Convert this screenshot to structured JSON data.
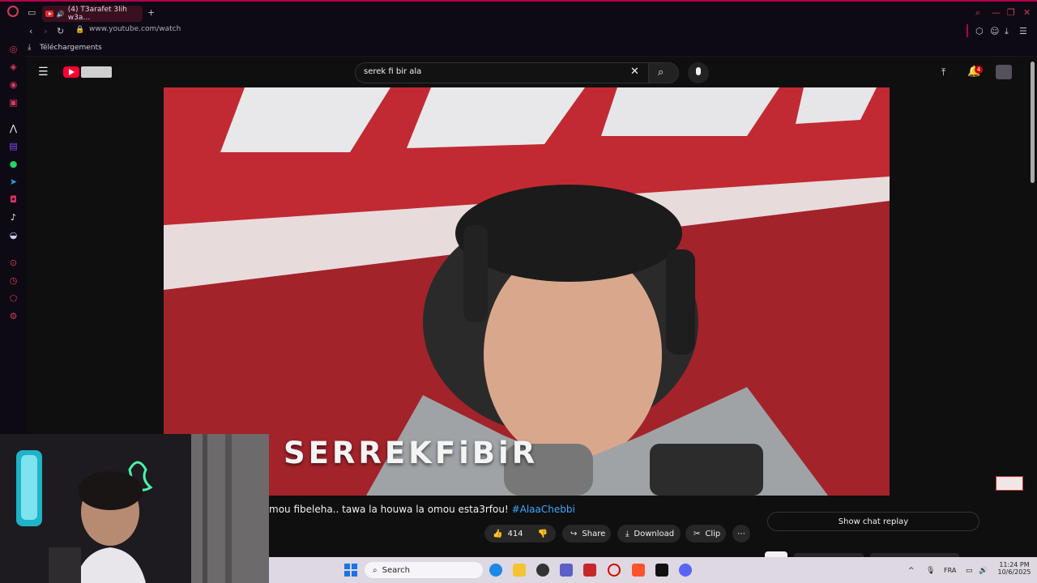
{
  "browser": {
    "tab_title": "(4) T3arafet 3lih w3a…",
    "url": "www.youtube.com/watch",
    "downloads_label": "Téléchargements",
    "accent_color": "#b3004a"
  },
  "youtube": {
    "search_query": "serek fi bir ala",
    "notification_count": "4"
  },
  "video": {
    "caption": "SERREKFiBiR",
    "title_text": "mou fibeleha.. tawa la houwa la omou esta3rfou!",
    "hashtag": "#AlaaChebbi",
    "likes": "414",
    "share_label": "Share",
    "download_label": "Download",
    "clip_label": "Clip",
    "chat_replay_label": "Show chat replay"
  },
  "taskbar": {
    "search_placeholder": "Search",
    "language": "FRA",
    "time": "11:24 PM",
    "date": "10/6/2025"
  }
}
